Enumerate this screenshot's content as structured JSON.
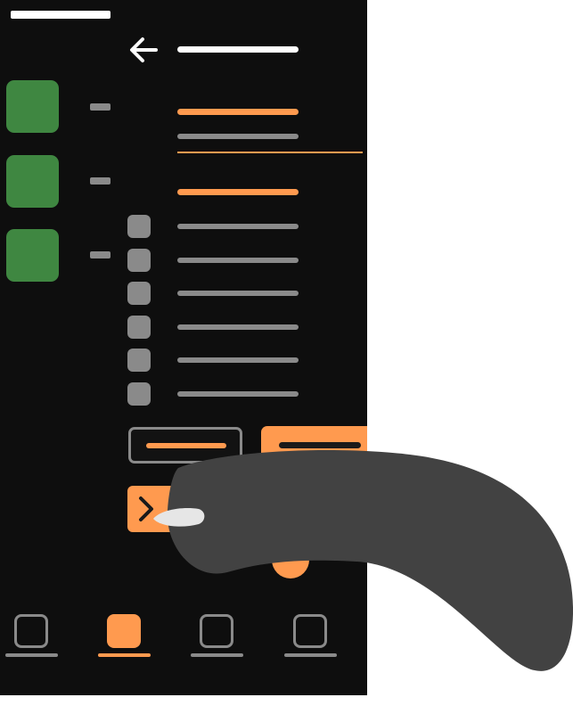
{
  "colors": {
    "background": "#0e0e0e",
    "accent": "#ff9a4f",
    "muted": "#8a8a8a",
    "tile": "#3f8741",
    "text": "#ffffff"
  },
  "icons": {
    "back": "arrow-left-icon",
    "code": "chevron-right-icon"
  },
  "bottom_nav": {
    "active_index": 1,
    "tab_count": 4
  }
}
